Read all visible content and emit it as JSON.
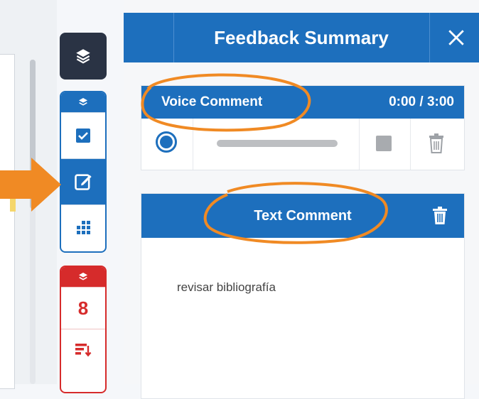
{
  "panel": {
    "title": "Feedback Summary"
  },
  "voice_comment": {
    "title": "Voice Comment",
    "time": "0:00 / 3:00",
    "progress": 0
  },
  "text_comment": {
    "title": "Text Comment",
    "body": "revisar bibliografía"
  },
  "rail": {
    "red_count": "8"
  },
  "colors": {
    "primary": "#1d6fbd",
    "dark": "#2a3344",
    "red": "#d62b2b",
    "annotation": "#f08a24"
  },
  "icons": [
    "layers-icon",
    "checkbox-icon",
    "edit-icon",
    "grid-icon",
    "sort-icon",
    "close-icon",
    "trash-icon",
    "record-icon",
    "stop-icon"
  ]
}
